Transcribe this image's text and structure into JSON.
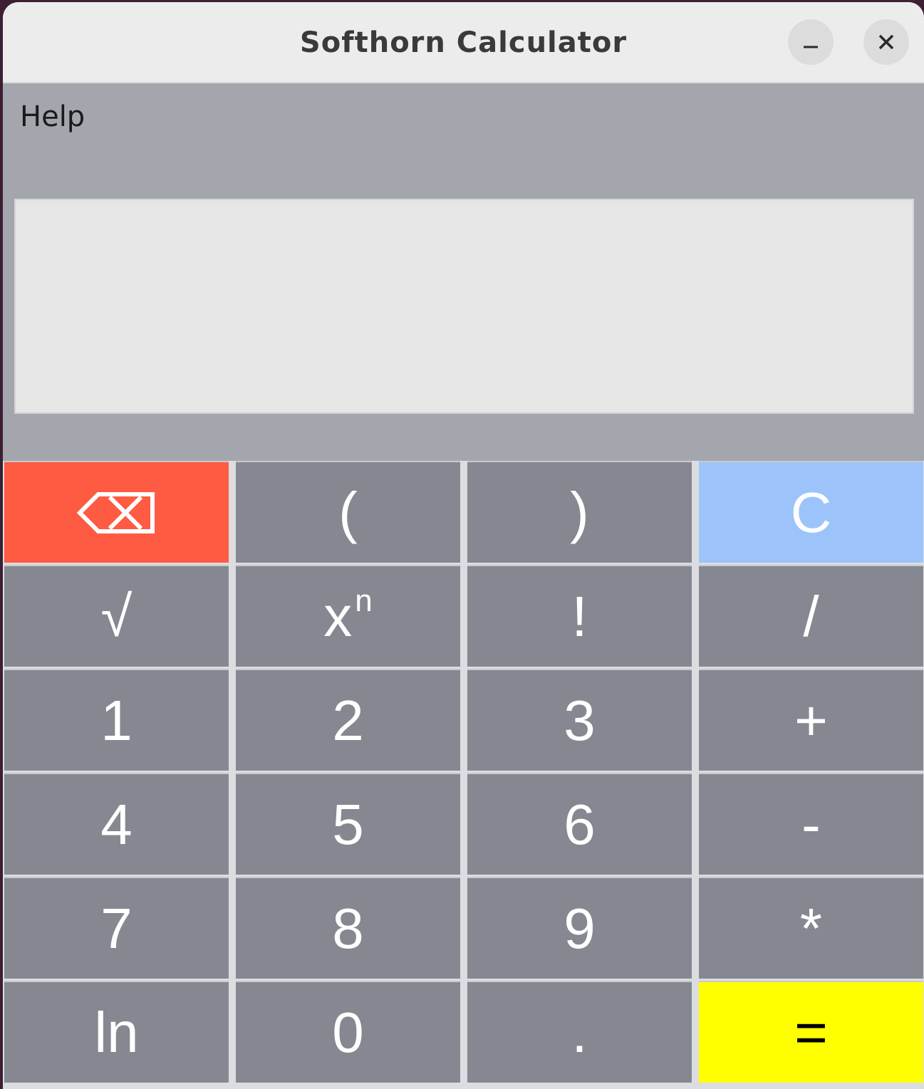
{
  "window": {
    "title": "Softhorn Calculator",
    "minimize_icon": "minimize-icon",
    "close_icon": "close-icon"
  },
  "menu": {
    "help_label": "Help"
  },
  "display": {
    "value": ""
  },
  "keys": {
    "backspace_icon": "backspace-icon",
    "open_paren": "(",
    "close_paren": ")",
    "clear": "C",
    "sqrt": "√",
    "power_base": "x",
    "power_exp": "n",
    "factorial": "!",
    "divide": "/",
    "one": "1",
    "two": "2",
    "three": "3",
    "plus": "+",
    "four": "4",
    "five": "5",
    "six": "6",
    "minus": "-",
    "seven": "7",
    "eight": "8",
    "nine": "9",
    "multiply": "*",
    "ln": "ln",
    "zero": "0",
    "decimal": ".",
    "equals": "="
  },
  "colors": {
    "backspace": "#ff5a42",
    "clear": "#9cc4fa",
    "equals": "#ffff00",
    "key": "#858890"
  }
}
